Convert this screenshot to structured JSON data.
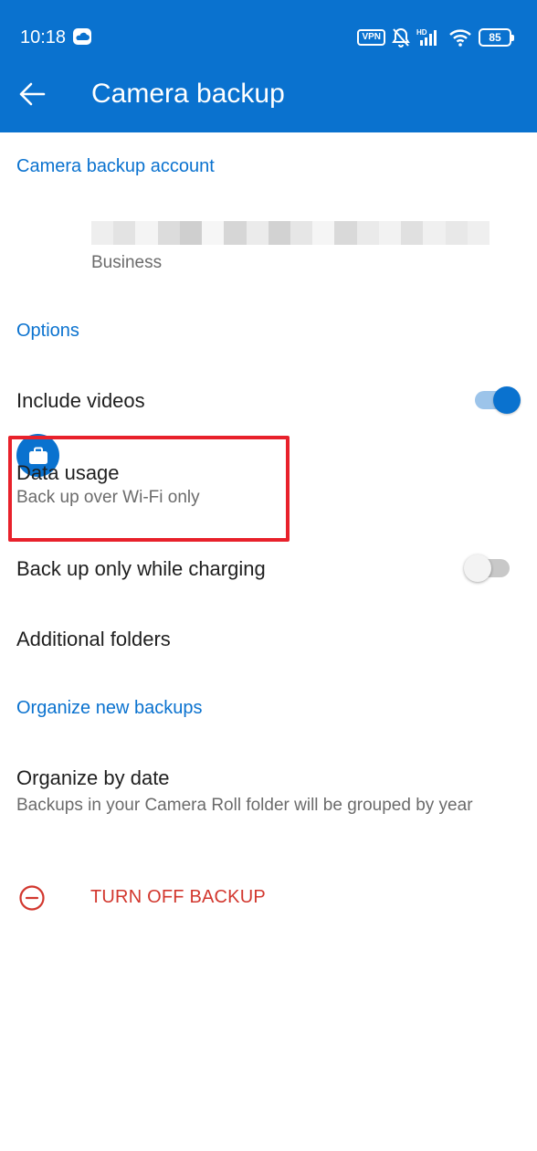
{
  "status_bar": {
    "time": "10:18",
    "vpn_label": "VPN",
    "battery_level": "85",
    "icons": [
      "cloud-notification-icon",
      "vpn-icon",
      "bell-off-icon",
      "hd-signal-icon",
      "wifi-icon",
      "battery-icon"
    ]
  },
  "app_bar": {
    "back_icon": "arrow-left-icon",
    "title": "Camera backup"
  },
  "account_section": {
    "header": "Camera backup account",
    "account_type": "Business",
    "avatar_icon": "briefcase-icon"
  },
  "options_section": {
    "header": "Options",
    "include_videos": {
      "label": "Include videos",
      "enabled": true
    },
    "data_usage": {
      "label": "Data usage",
      "value": "Back up over Wi-Fi only"
    },
    "charging": {
      "label": "Back up only while charging",
      "enabled": false
    },
    "additional_folders": {
      "label": "Additional folders"
    }
  },
  "organize_section": {
    "header": "Organize new backups",
    "organize_by_date": {
      "label": "Organize by date",
      "description": "Backups in your Camera Roll folder will be grouped by year"
    }
  },
  "turn_off": {
    "label": "TURN OFF BACKUP",
    "icon": "minus-circle-icon"
  },
  "colors": {
    "accent": "#0a72cf",
    "danger": "#d2372e",
    "highlight": "#e8212b"
  }
}
